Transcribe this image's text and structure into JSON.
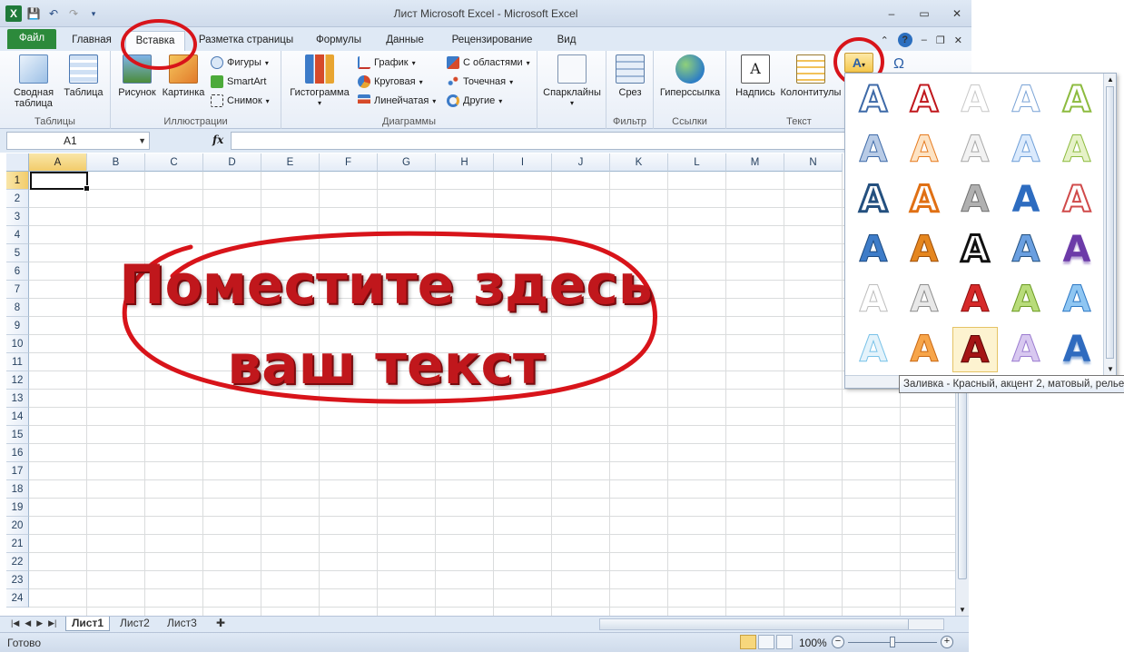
{
  "window": {
    "title": "Лист Microsoft Excel  -  Microsoft Excel"
  },
  "tabs": [
    {
      "label": "Файл"
    },
    {
      "label": "Главная"
    },
    {
      "label": "Вставка"
    },
    {
      "label": "Разметка страницы"
    },
    {
      "label": "Формулы"
    },
    {
      "label": "Данные"
    },
    {
      "label": "Рецензирование"
    },
    {
      "label": "Вид"
    }
  ],
  "ribbon": {
    "groups": {
      "tables": "Таблицы",
      "illustrations": "Иллюстрации",
      "charts": "Диаграммы",
      "filter": "Фильтр",
      "links": "Ссылки",
      "text": "Текст"
    },
    "buttons": {
      "pivot1": "Сводная",
      "pivot2": "таблица",
      "table": "Таблица",
      "picture": "Рисунок",
      "clipart": "Картинка",
      "shapes": "Фигуры",
      "smartart": "SmartArt",
      "screenshot": "Снимок",
      "histogram": "Гистограмма",
      "line": "График",
      "pie": "Круговая",
      "bar": "Линейчатая",
      "area": "С областями",
      "scatter": "Точечная",
      "other": "Другие",
      "sparklines": "Спарклайны",
      "slicer": "Срез",
      "hyperlink": "Гиперссылка",
      "textbox": "Надпись",
      "headerfooter": "Колонтитулы"
    }
  },
  "formula_bar": {
    "name_box": "A1",
    "fx": "fx",
    "value": ""
  },
  "grid": {
    "columns": [
      "A",
      "B",
      "C",
      "D",
      "E",
      "F",
      "G",
      "H",
      "I",
      "J",
      "K",
      "L",
      "M",
      "N"
    ],
    "rows": [
      "1",
      "2",
      "3",
      "4",
      "5",
      "6",
      "7",
      "8",
      "9",
      "10",
      "11",
      "12",
      "13",
      "14",
      "15",
      "16",
      "17",
      "18",
      "19",
      "20",
      "21",
      "22",
      "23",
      "24"
    ]
  },
  "overlay": {
    "line1": "Поместите здесь",
    "line2": "ваш текст"
  },
  "sheets": [
    "Лист1",
    "Лист2",
    "Лист3"
  ],
  "status": {
    "ready": "Готово",
    "zoom": "100%"
  },
  "tooltip": "Заливка - Красный, акцент 2, матовый, рельеф",
  "wordart_letter": "A",
  "colors": {
    "accent_red": "#c0171c",
    "file_tab": "#2c8a3b"
  }
}
